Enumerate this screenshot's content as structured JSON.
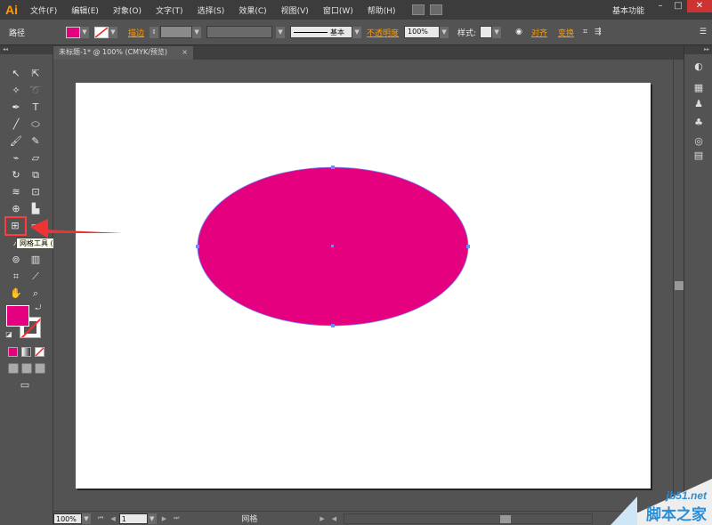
{
  "app": {
    "logo": "Ai",
    "workspace": "基本功能",
    "window_buttons": [
      "–",
      "□",
      "✕"
    ]
  },
  "menu": [
    "文件(F)",
    "编辑(E)",
    "对象(O)",
    "文字(T)",
    "选择(S)",
    "效果(C)",
    "视图(V)",
    "窗口(W)",
    "帮助(H)"
  ],
  "control": {
    "selection_label": "路径",
    "fill_color": "#e4007f",
    "stroke_link": "描边",
    "stroke_profile_label": "基本",
    "opacity_link": "不透明度",
    "opacity_value": "100%",
    "style_label": "样式:",
    "align_link": "对齐",
    "transform_link": "变换"
  },
  "document": {
    "tab_title": "未标题-1* @ 100% (CMYK/预览)",
    "tab_close": "×"
  },
  "tooltip": "网格工具 (U)",
  "status": {
    "zoom": "100%",
    "artboard": "1",
    "current_tool": "网格"
  },
  "colors": {
    "accent_orange": "#ff9a00",
    "fill": "#e4007f",
    "highlight_red": "#ff3b3b",
    "anchor_blue": "#6c8cff"
  },
  "icons": {
    "tools": [
      "selection-icon",
      "direct-selection-icon",
      "magic-wand-icon",
      "lasso-icon",
      "pen-icon",
      "type-icon",
      "line-icon",
      "ellipse-icon",
      "paintbrush-icon",
      "pencil-icon",
      "blob-brush-icon",
      "eraser-icon",
      "rotate-icon",
      "scale-icon",
      "warp-icon",
      "free-transform-icon",
      "shape-builder-icon",
      "perspective-grid-icon",
      "mesh-icon",
      "gradient-icon",
      "eyedropper-icon",
      "blend-icon",
      "symbol-sprayer-icon",
      "column-graph-icon",
      "artboard-icon",
      "slice-icon",
      "hand-icon",
      "zoom-icon"
    ],
    "dock": [
      "color-panel-icon",
      "swatches-icon",
      "brushes-icon",
      "symbols-icon",
      "appearance-icon",
      "layers-icon"
    ]
  },
  "watermark": {
    "url": "jb51.net",
    "name": "脚本之家"
  }
}
